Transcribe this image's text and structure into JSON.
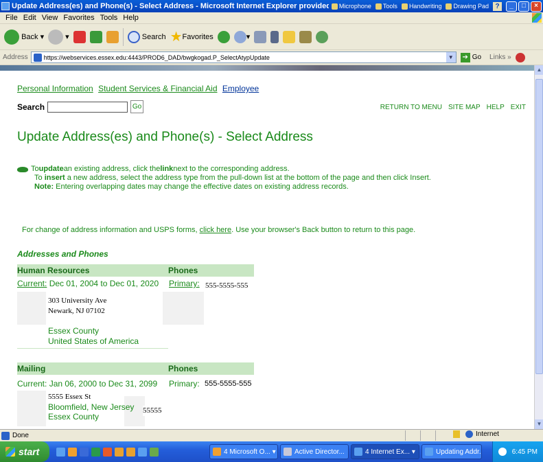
{
  "window": {
    "title": "Update Address(es) and Phone(s) - Select Address - Microsoft Internet Explorer provided by",
    "tools": [
      "Microphone",
      "Tools",
      "Handwriting",
      "Drawing Pad"
    ]
  },
  "menu": [
    "File",
    "Edit",
    "View",
    "Favorites",
    "Tools",
    "Help"
  ],
  "toolbar": {
    "back": "Back",
    "search": "Search",
    "favorites": "Favorites"
  },
  "address_bar": {
    "label": "Address",
    "url": "https://webservices.essex.edu:4443/PROD6_DAD/bwgkogad.P_SelectAtypUpdate",
    "go": "Go",
    "links": "Links"
  },
  "nav": {
    "personal": "Personal Information",
    "student": "Student Services & Financial Aid",
    "employee": "Employee"
  },
  "search": {
    "label": "Search",
    "go": "Go",
    "value": ""
  },
  "top_links": [
    "RETURN TO MENU",
    "SITE MAP",
    "HELP",
    "EXIT"
  ],
  "page_title": "Update Address(es) and Phone(s) - Select Address",
  "instructions": {
    "l1_pre": "To ",
    "l1_b1": "update",
    "l1_mid": " an existing address, click the ",
    "l1_b2": "link",
    "l1_post": " next to the corresponding address.",
    "l2_pre": "To ",
    "l2_b": "insert",
    "l2_post": " a new address, select the address type from the pull-down list at the bottom of the page and then click Insert.",
    "l3_b": "Note:",
    "l3_post": " Entering overlapping dates may change the effective dates on existing address records."
  },
  "change": {
    "pre": "For change of address information and USPS forms, ",
    "link": "click here",
    "post": ". Use your browser's Back button to return to this page."
  },
  "section_title": "Addresses and Phones",
  "addresses": [
    {
      "type": "Human Resources",
      "phones_header": "Phones",
      "status": "Current:",
      "dates": "Dec 01, 2004 to Dec 01, 2020",
      "phone_type": "Primary:",
      "phone": "555-5555-555",
      "street": "303 University Ave",
      "city": "Newark, NJ 07102",
      "county": "Essex County",
      "country": "United States of America"
    },
    {
      "type": "Mailing",
      "phones_header": "Phones",
      "status": "Current:",
      "dates": "Jan 06, 2000 to Dec 31, 2099",
      "phone_type": "Primary:",
      "phone": "555-5555-555",
      "street": "5555 Essex St",
      "city": "Bloomfield, New Jersey",
      "zip": "55555",
      "county": "Essex County"
    }
  ],
  "status_bar": {
    "text": "Done",
    "zone": "Internet"
  },
  "taskbar": {
    "start": "start",
    "tasks": [
      "4 Microsoft O...",
      "Active Director...",
      "4 Internet Ex...",
      "Updating Addr..."
    ],
    "clock": "6:45 PM"
  }
}
